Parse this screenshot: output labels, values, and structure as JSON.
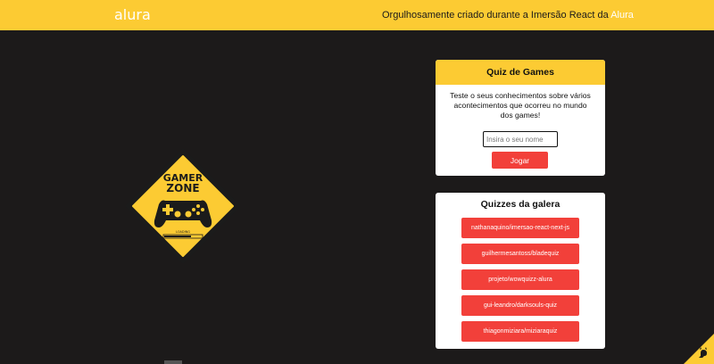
{
  "header": {
    "logo": "alura",
    "tagline": "Orgulhosamente criado durante a Imersão React da",
    "tagline_link": "Alura"
  },
  "emblem": {
    "title_line1": "GAMER",
    "title_line2": "ZONE",
    "loading": "LOADING"
  },
  "quiz_card": {
    "title": "Quiz de Games",
    "description": "Teste o seus conhecimentos sobre vários acontecimentos que ocorreu no mundo dos games!",
    "input_placeholder": "Insira o seu nome",
    "play_label": "Jogar"
  },
  "gallery_card": {
    "title": "Quizzes da galera",
    "items": [
      {
        "label": "nathanaquino/imersao-react-next-js"
      },
      {
        "label": "guilhermesantoss/bladequiz"
      },
      {
        "label": "projeto/wowquizz-alura"
      },
      {
        "label": "gui-leandro/darksouls-quiz"
      },
      {
        "label": "thiagonmiziara/miziaraquiz"
      }
    ]
  },
  "colors": {
    "accent": "#fccb33",
    "button": "#f2403a",
    "background": "#1c1a1a"
  }
}
